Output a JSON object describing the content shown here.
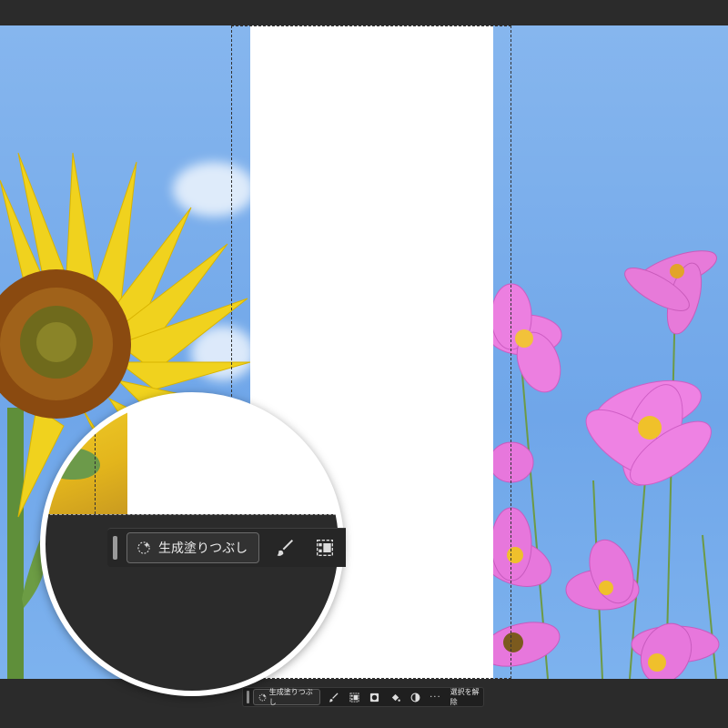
{
  "canvas": {
    "sky_color": "#7aaeea",
    "fill_color": "#ffffff",
    "left_photo": "sunflower",
    "right_photo": "pink-cosmos-flowers"
  },
  "contextual_task_bar": {
    "generative_fill_label": "生成塗りつぶし",
    "generative_fill_icon": "sparkle-icon",
    "icons": [
      "brush-icon",
      "transform-icon",
      "mask-icon",
      "fill-bucket-icon",
      "contrast-icon"
    ],
    "more_label": "···",
    "deselect_label": "選択を解除"
  },
  "magnifier": {
    "generative_fill_label": "生成塗りつぶし"
  }
}
